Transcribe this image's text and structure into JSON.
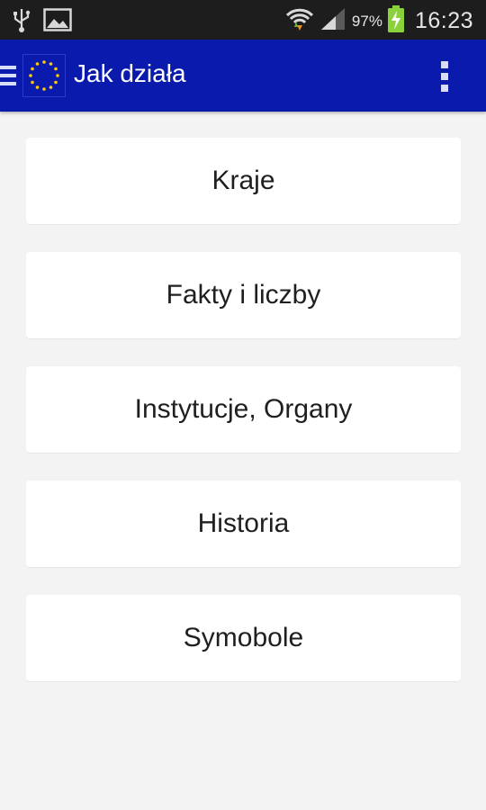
{
  "status_bar": {
    "battery_percent": "97%",
    "time": "16:23",
    "icons": [
      "usb-icon",
      "image-notification-icon",
      "wifi-icon",
      "signal-icon",
      "battery-charging-icon"
    ]
  },
  "app_bar": {
    "title": "Jak działa",
    "icons": [
      "menu-icon",
      "eu-flag-icon",
      "overflow-menu-icon"
    ],
    "color": "#0a1aad"
  },
  "menu": {
    "items": [
      {
        "label": "Kraje"
      },
      {
        "label": "Fakty i liczby"
      },
      {
        "label": "Instytucje, Organy"
      },
      {
        "label": "Historia"
      },
      {
        "label": "Symobole"
      }
    ]
  }
}
